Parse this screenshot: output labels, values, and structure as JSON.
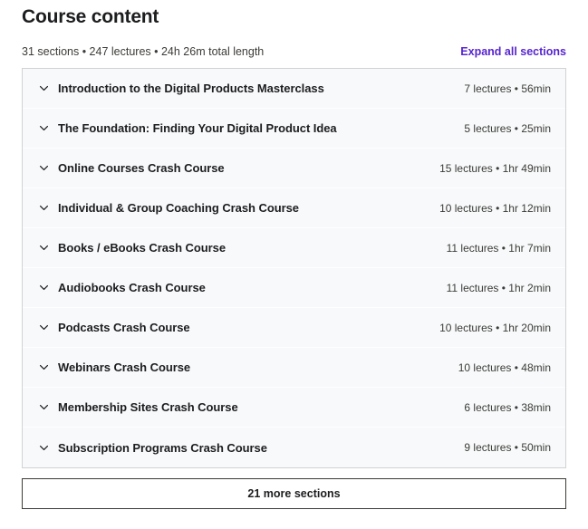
{
  "header": {
    "title": "Course content",
    "summary": "31 sections • 247 lectures • 24h 26m total length",
    "expand_all_label": "Expand all sections",
    "link_color": "#5624d0"
  },
  "sections": [
    {
      "title": "Introduction to the Digital Products Masterclass",
      "meta": "7 lectures • 56min",
      "icon": "chevron-down-icon"
    },
    {
      "title": "The Foundation: Finding Your Digital Product Idea",
      "meta": "5 lectures • 25min",
      "icon": "chevron-down-icon"
    },
    {
      "title": "Online Courses Crash Course",
      "meta": "15 lectures • 1hr 49min",
      "icon": "chevron-down-icon"
    },
    {
      "title": "Individual & Group Coaching Crash Course",
      "meta": "10 lectures • 1hr 12min",
      "icon": "chevron-down-icon"
    },
    {
      "title": "Books / eBooks Crash Course",
      "meta": "11 lectures • 1hr 7min",
      "icon": "chevron-down-icon"
    },
    {
      "title": "Audiobooks Crash Course",
      "meta": "11 lectures • 1hr 2min",
      "icon": "chevron-down-icon"
    },
    {
      "title": "Podcasts Crash Course",
      "meta": "10 lectures • 1hr 20min",
      "icon": "chevron-down-icon"
    },
    {
      "title": "Webinars Crash Course",
      "meta": "10 lectures • 48min",
      "icon": "chevron-down-icon"
    },
    {
      "title": "Membership Sites Crash Course",
      "meta": "6 lectures • 38min",
      "icon": "chevron-down-icon"
    },
    {
      "title": "Subscription Programs Crash Course",
      "meta": "9 lectures • 50min",
      "icon": "chevron-down-icon"
    }
  ],
  "footer": {
    "more_sections_label": "21 more sections"
  }
}
